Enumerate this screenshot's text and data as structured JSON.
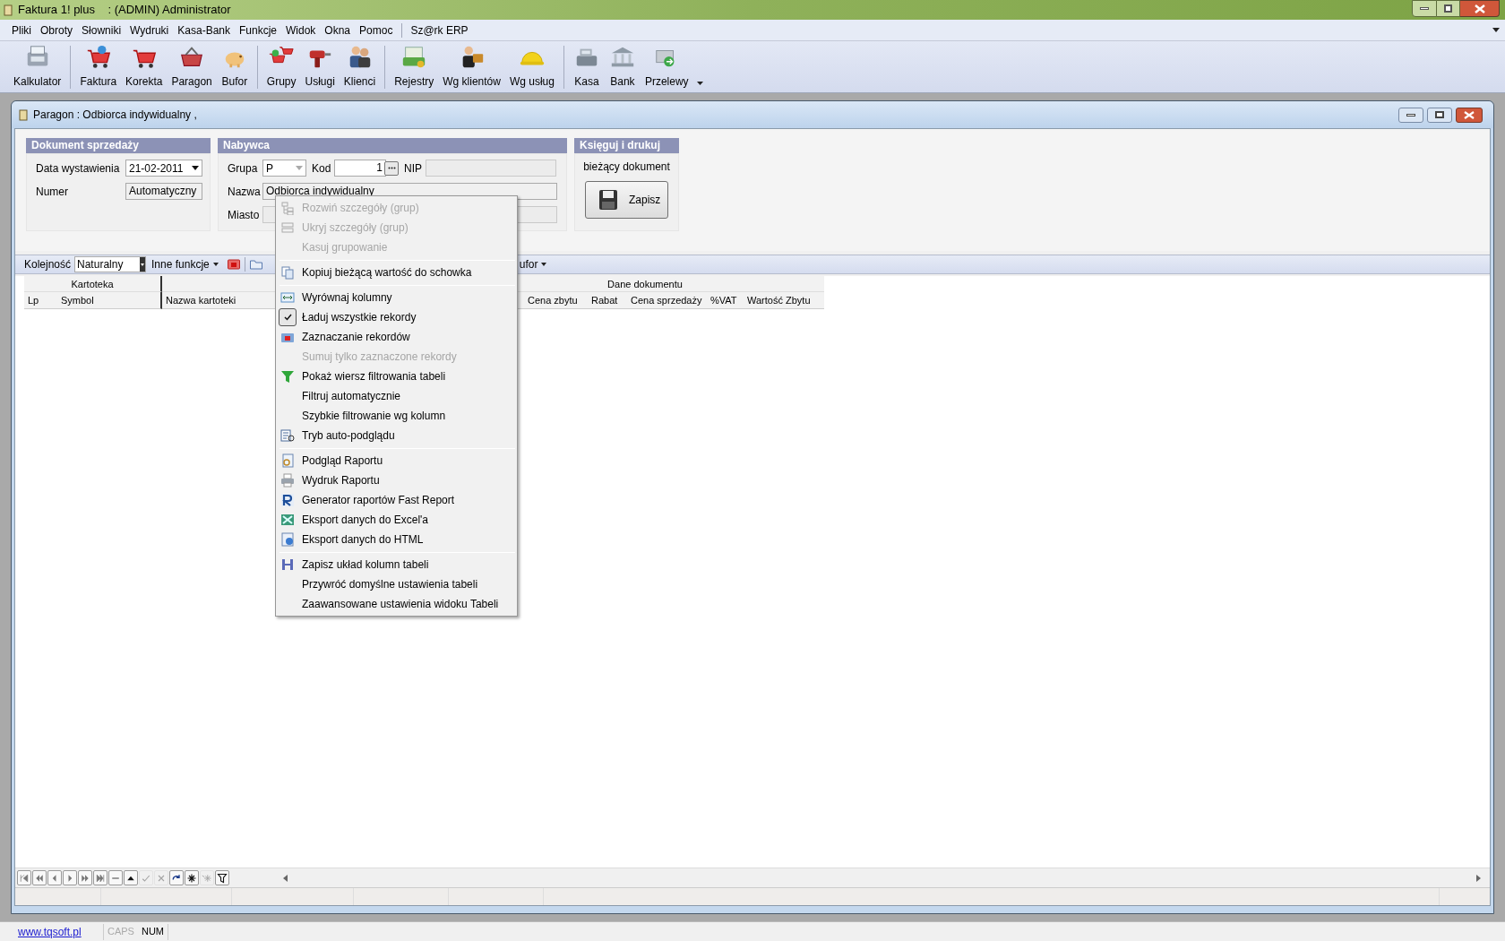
{
  "window": {
    "title": "Faktura 1! plus    : (ADMIN) Administrator"
  },
  "menu_bar": {
    "items": [
      "Pliki",
      "Obroty",
      "Słowniki",
      "Wydruki",
      "Kasa-Bank",
      "Funkcje",
      "Widok",
      "Okna",
      "Pomoc"
    ],
    "external": [
      "Sz@rk ERP"
    ]
  },
  "toolbar": {
    "groups": [
      [
        "Kalkulator"
      ],
      [
        "Faktura",
        "Korekta",
        "Paragon",
        "Bufor"
      ],
      [
        "Grupy",
        "Usługi",
        "Klienci"
      ],
      [
        "Rejestry",
        "Wg klientów",
        "Wg usług"
      ],
      [
        "Kasa",
        "Bank",
        "Przelewy"
      ]
    ]
  },
  "document_window": {
    "title": "Paragon : Odbiorca indywidualny ,"
  },
  "sale_document": {
    "header": "Dokument sprzedaży",
    "date_label": "Data wystawienia",
    "date": "21-02-2011",
    "number_label": "Numer",
    "number": "Automatyczny"
  },
  "buyer": {
    "header": "Nabywca",
    "group_label": "Grupa",
    "group": "P",
    "code_label": "Kod",
    "code": "1",
    "nip_label": "NIP",
    "name_label": "Nazwa",
    "name": "Odbiorca indywidualny",
    "city_label": "Miasto"
  },
  "post": {
    "header": "Księguj i drukuj",
    "caption": "bieżący dokument",
    "save_button": "Zapisz"
  },
  "grid_toolbar": {
    "order_label": "Kolejność",
    "order": "Naturalny",
    "other_functions": "Inne funkcje",
    "partial": "ufor"
  },
  "grid": {
    "bands": [
      "Kartoteka",
      "Dane dokumentu"
    ],
    "columns": [
      "Lp",
      "Symbol",
      "Nazwa kartoteki",
      "Cena zbytu",
      "Rabat",
      "Cena sprzedaży",
      "%VAT",
      "Wartość Zbytu"
    ]
  },
  "navigator": [
    {
      "disabled": false
    },
    {
      "disabled": false
    },
    {
      "disabled": false
    },
    {
      "disabled": false
    },
    {
      "disabled": false
    },
    {
      "disabled": false
    },
    {
      "disabled": false
    },
    {
      "disabled": false
    },
    {
      "disabled": true
    },
    {
      "disabled": true
    },
    {
      "disabled": false
    },
    {
      "disabled": false
    },
    {
      "disabled": true
    },
    {
      "disabled": false
    }
  ],
  "context_menu": [
    {
      "kind": "item",
      "label": "Rozwiń szczegóły (grup)",
      "disabled": true,
      "checked": false
    },
    {
      "kind": "item",
      "label": "Ukryj szczegóły (grup)",
      "disabled": true,
      "checked": false
    },
    {
      "kind": "item",
      "label": "Kasuj grupowanie",
      "disabled": true,
      "checked": false
    },
    {
      "kind": "separator"
    },
    {
      "kind": "item",
      "label": "Kopiuj bieżącą wartość do schowka",
      "disabled": false,
      "checked": false
    },
    {
      "kind": "separator"
    },
    {
      "kind": "item",
      "label": "Wyrównaj kolumny",
      "disabled": false,
      "checked": false
    },
    {
      "kind": "item",
      "label": "Ładuj wszystkie rekordy",
      "disabled": false,
      "checked": true
    },
    {
      "kind": "item",
      "label": "Zaznaczanie rekordów",
      "disabled": false,
      "checked": false
    },
    {
      "kind": "item",
      "label": "Sumuj tylko zaznaczone rekordy",
      "disabled": true,
      "checked": false
    },
    {
      "kind": "item",
      "label": "Pokaż wiersz filtrowania tabeli",
      "disabled": false,
      "checked": false
    },
    {
      "kind": "item",
      "label": "Filtruj automatycznie",
      "disabled": false,
      "checked": false
    },
    {
      "kind": "item",
      "label": "Szybkie filtrowanie wg kolumn",
      "disabled": false,
      "checked": false
    },
    {
      "kind": "item",
      "label": "Tryb auto-podglądu",
      "disabled": false,
      "checked": false
    },
    {
      "kind": "separator"
    },
    {
      "kind": "item",
      "label": "Podgląd Raportu",
      "disabled": false,
      "checked": false
    },
    {
      "kind": "item",
      "label": "Wydruk Raportu",
      "disabled": false,
      "checked": false
    },
    {
      "kind": "item",
      "label": "Generator raportów Fast Report",
      "disabled": false,
      "checked": false
    },
    {
      "kind": "item",
      "label": "Eksport danych do Excel'a",
      "disabled": false,
      "checked": false
    },
    {
      "kind": "item",
      "label": "Eksport danych do HTML",
      "disabled": false,
      "checked": false
    },
    {
      "kind": "separator"
    },
    {
      "kind": "item",
      "label": "Zapisz układ kolumn tabeli",
      "disabled": false,
      "checked": false
    },
    {
      "kind": "item",
      "label": "Przywróć domyślne ustawienia tabeli",
      "disabled": false,
      "checked": false
    },
    {
      "kind": "item",
      "label": "Zaawansowane ustawienia widoku Tabeli",
      "disabled": false,
      "checked": false
    }
  ],
  "status_bar": {
    "link": "www.tqsoft.pl",
    "indicators": [
      {
        "label": "CAPS",
        "on": false
      },
      {
        "label": "NUM",
        "on": true
      }
    ]
  }
}
